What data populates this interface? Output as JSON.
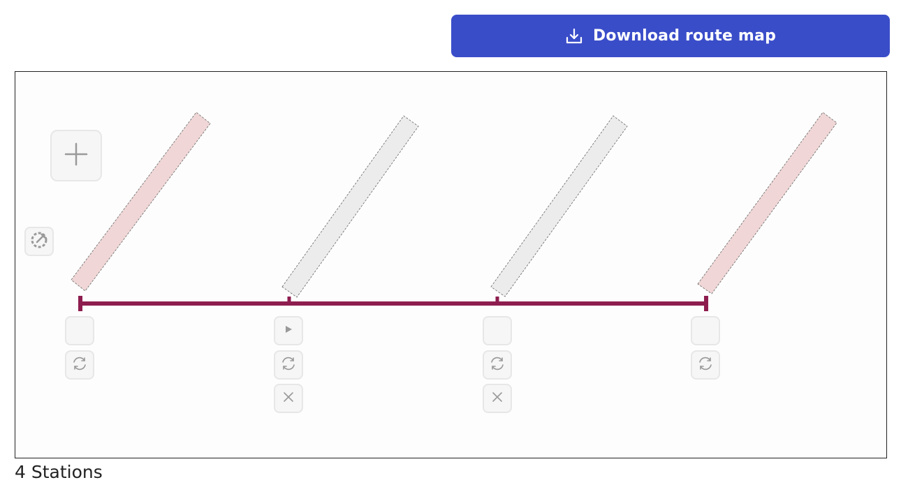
{
  "toolbar": {
    "download_label": "Download route map",
    "download_icon": "download-icon"
  },
  "map": {
    "line_color": "#8e1d4f",
    "station_count": 4,
    "stations": [
      {
        "highlighted": true,
        "label_color": "#f0d6d6",
        "controls": [
          "blank",
          "rotate"
        ]
      },
      {
        "highlighted": false,
        "label_color": "#ececec",
        "controls": [
          "play",
          "rotate",
          "remove"
        ]
      },
      {
        "highlighted": false,
        "label_color": "#ececec",
        "controls": [
          "blank",
          "rotate",
          "remove"
        ]
      },
      {
        "highlighted": true,
        "label_color": "#f0d6d6",
        "controls": [
          "blank",
          "rotate"
        ]
      }
    ],
    "add_icon": "plus-icon",
    "color_icon": "color-picker-icon"
  },
  "footer": {
    "station_count_label": "4 Stations"
  }
}
